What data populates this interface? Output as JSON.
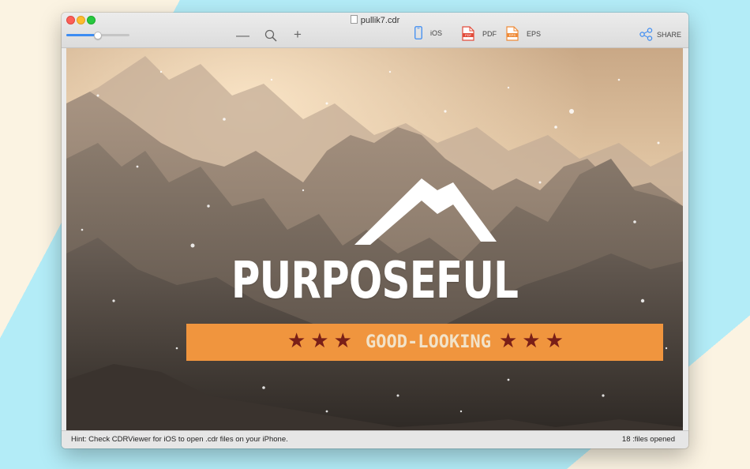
{
  "window": {
    "title": "pullik7.cdr"
  },
  "toolbar": {
    "zoom_level": 0.5,
    "ios_label": "iOS",
    "pdf_label": "PDF",
    "eps_label": "EPS",
    "share_label": "SHARE",
    "pdf_icon_text": "PDF",
    "eps_icon_text": "EPS"
  },
  "artwork": {
    "headline": "PURPOSEFUL",
    "tagline": "GOOD-LOOKING",
    "stars_left": "★★★",
    "stars_right": "★★★",
    "colors": {
      "banner": "#f0953e",
      "stars": "#7a1f17",
      "tagline": "#f2e3c9",
      "headline": "#ffffff"
    }
  },
  "status": {
    "hint": "Hint: Check CDRViewer for iOS to open .cdr files on your iPhone.",
    "files_opened": "18 :files opened"
  },
  "colors": {
    "accent": "#3d8cf2",
    "background_blue": "#b3ecf7",
    "background_cream": "#fbf3e2"
  }
}
